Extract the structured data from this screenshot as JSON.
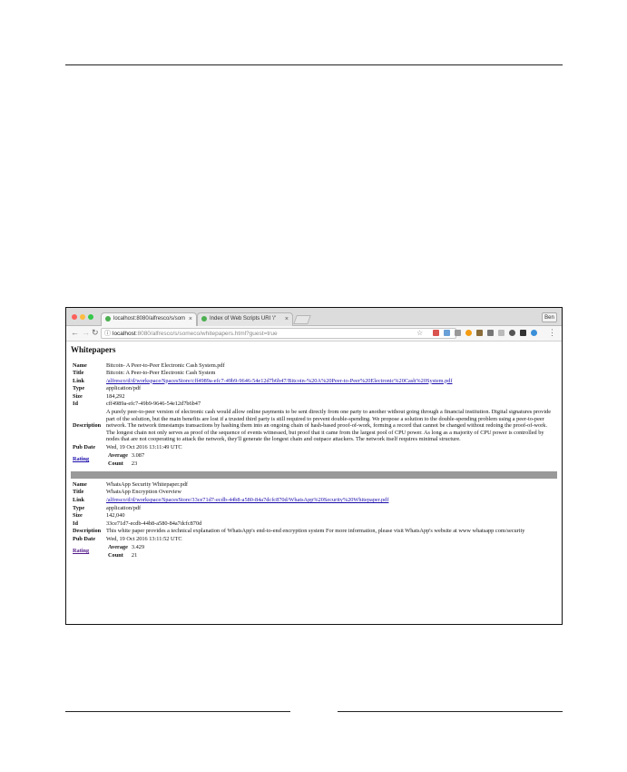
{
  "browser": {
    "tabs": [
      {
        "title": "localhost:8080/alfresco/s/som",
        "close": "×"
      },
      {
        "title": "Index of Web Scripts URI '/'",
        "close": "×"
      }
    ],
    "user_button": "Ben",
    "url_host": "localhost",
    "url_rest": ":8080/alfresco/s/someco/whitepapers.html?guest=true"
  },
  "page": {
    "heading": "Whitepapers",
    "labels": {
      "name": "Name",
      "title": "Title",
      "link": "Link",
      "type": "Type",
      "size": "Size",
      "id": "Id",
      "description": "Description",
      "pub_date": "Pub Date",
      "rating": "Rating",
      "average": "Average",
      "count": "Count"
    },
    "papers": [
      {
        "name": "Bitcoin- A Peer-to-Peer Electronic Cash System.pdf",
        "title": "Bitcoin: A Peer-to-Peer Electronic Cash System",
        "link": "/alfresco/d/d/workspace/SpacesStore/cff4989a-efc7-49b9-9646-54e12d7b6b47/Bitcoin-%20A%20Peer-to-Peer%20Electronic%20Cash%20System.pdf",
        "type": "application/pdf",
        "size": "184,292",
        "id": "cff4989a-efc7-49b9-9646-54e12d7b6b47",
        "description": "A purely peer-to-peer version of electronic cash would allow online payments to be sent directly from one party to another without going through a financial institution. Digital signatures provide part of the solution, but the main benefits are lost if a trusted third party is still required to prevent double-spending. We propose a solution to the double-spending problem using a peer-to-peer network. The network timestamps transactions by hashing them into an ongoing chain of hash-based proof-of-work, forming a record that cannot be changed without redoing the proof-of-work. The longest chain not only serves as proof of the sequence of events witnessed, but proof that it came from the largest pool of CPU power. As long as a majority of CPU power is controlled by nodes that are not cooperating to attack the network, they'll generate the longest chain and outpace attackers. The network itself requires minimal structure.",
        "pub_date": "Wed, 19 Oct 2016 13:11:49 UTC",
        "average": "3.087",
        "count": "23"
      },
      {
        "name": "WhatsApp Security Whitepaper.pdf",
        "title": "WhatsApp Encryption Overview",
        "link": "/alfresco/d/d/workspace/SpacesStore/33ce71d7-ecdb-44b8-a580-84a7dcfc870d/WhatsApp%20Security%20Whitepaper.pdf",
        "type": "application/pdf",
        "size": "142,040",
        "id": "33ce71d7-ecdb-44b8-a580-84a7dcfc870d",
        "description": "This white paper provides a technical explanation of WhatsApp's end-to-end encryption system For more information, please visit WhatsApp's website at www whatsapp com/security",
        "pub_date": "Wed, 19 Oct 2016 13:11:52 UTC",
        "average": "3.429",
        "count": "21"
      }
    ]
  },
  "colors": {
    "link": "#1a0dab",
    "visited_link": "#551a8b",
    "separator": "#999999"
  }
}
